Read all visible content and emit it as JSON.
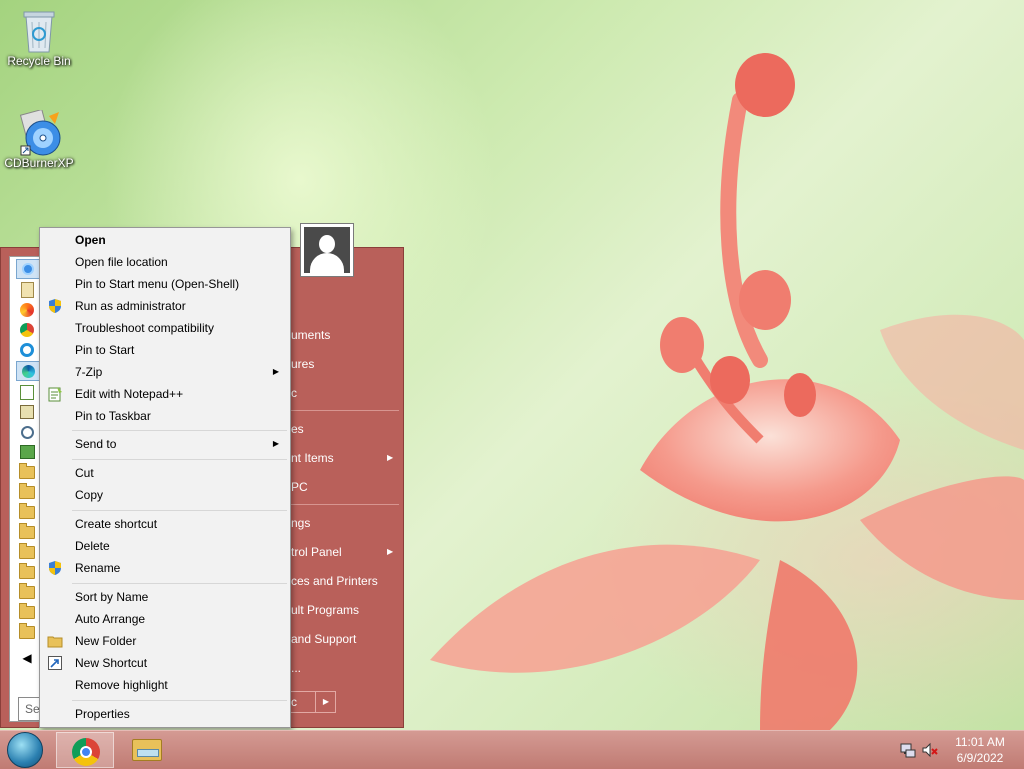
{
  "desktop": {
    "icons": [
      {
        "label": "Recycle Bin",
        "icon": "recycle-bin-icon"
      },
      {
        "label": "CDBurnerXP",
        "icon": "cdburnerxp-icon"
      }
    ]
  },
  "start_menu": {
    "search_placeholder": "Se",
    "right_items": [
      {
        "label": "uments"
      },
      {
        "label": "ures"
      },
      {
        "label": "c"
      },
      {
        "label": "es"
      },
      {
        "label": "nt Items",
        "submenu": true
      },
      {
        "label": "PC"
      },
      {
        "label": "ngs"
      },
      {
        "label": "trol Panel",
        "submenu": true
      },
      {
        "label": "ces and Printers"
      },
      {
        "label": "ult Programs"
      },
      {
        "label": "and Support"
      },
      {
        "label": "..."
      }
    ],
    "shutdown_partial": "c"
  },
  "context_menu": {
    "items": [
      {
        "label": "Open",
        "bold": true
      },
      {
        "label": "Open file location"
      },
      {
        "label": "Pin to Start menu (Open-Shell)"
      },
      {
        "label": "Run as administrator",
        "icon": "uac-shield-icon"
      },
      {
        "label": "Troubleshoot compatibility"
      },
      {
        "label": "Pin to Start"
      },
      {
        "label": "7-Zip",
        "submenu": true
      },
      {
        "label": "Edit with Notepad++",
        "icon": "notepad-plus-plus-icon"
      },
      {
        "label": "Pin to Taskbar"
      },
      {
        "label": "Send to",
        "submenu": true
      },
      {
        "label": "Cut"
      },
      {
        "label": "Copy"
      },
      {
        "label": "Create shortcut"
      },
      {
        "label": "Delete",
        "icon": "uac-shield-icon"
      },
      {
        "label": "Rename",
        "icon": "uac-shield-icon"
      },
      {
        "label": "Sort by Name"
      },
      {
        "label": "Auto Arrange"
      },
      {
        "label": "New Folder",
        "icon": "folder-icon"
      },
      {
        "label": "New Shortcut",
        "icon": "shortcut-icon"
      },
      {
        "label": "Remove highlight"
      },
      {
        "label": "Properties"
      }
    ]
  },
  "taskbar": {
    "clock_time": "11:01 AM",
    "clock_date": "6/9/2022"
  }
}
